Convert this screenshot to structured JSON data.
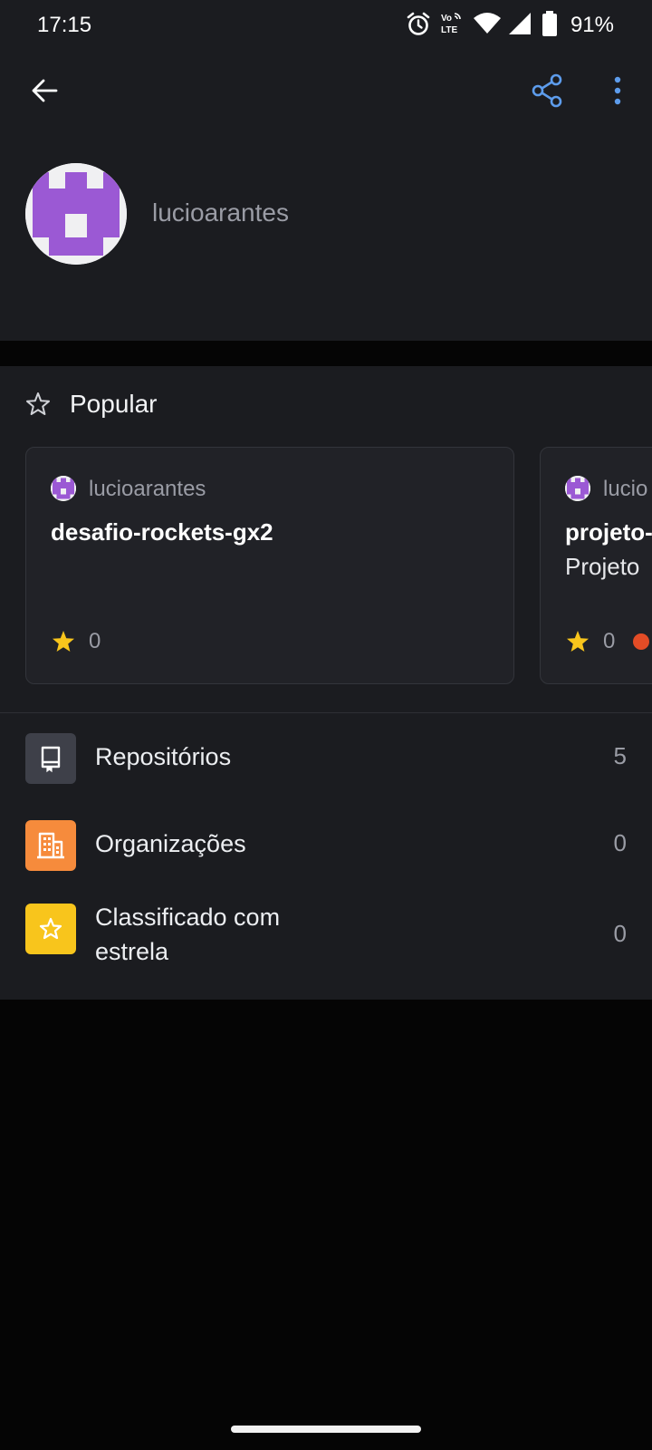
{
  "status_bar": {
    "time": "17:15",
    "battery": "91%",
    "icons": [
      "alarm-icon",
      "volte-icon",
      "wifi-icon",
      "cell-signal-icon",
      "battery-icon"
    ]
  },
  "app_bar": {
    "icons": [
      "back-arrow-icon",
      "share-icon",
      "more-vert-icon"
    ],
    "accent_color": "#5d9cec"
  },
  "profile": {
    "username": "lucioarantes",
    "avatar_color": "#9b59d4"
  },
  "popular": {
    "title": "Popular",
    "cards": [
      {
        "owner": "lucioarantes",
        "name": "desafio-rockets-gx2",
        "description": "",
        "stars": "0"
      },
      {
        "owner": "lucio",
        "name": "projeto-",
        "description": "Projeto",
        "stars": "0",
        "language_color": "#e34c26"
      }
    ]
  },
  "stats": {
    "items": [
      {
        "label": "Repositórios",
        "count": "5",
        "icon": "repo-icon",
        "color": "#3e4049"
      },
      {
        "label": "Organizações",
        "count": "0",
        "icon": "organization-icon",
        "color": "#f68b3c"
      },
      {
        "label": "Classificado com\nestrela",
        "count": "0",
        "icon": "star-icon",
        "color": "#f8c51c"
      }
    ]
  }
}
